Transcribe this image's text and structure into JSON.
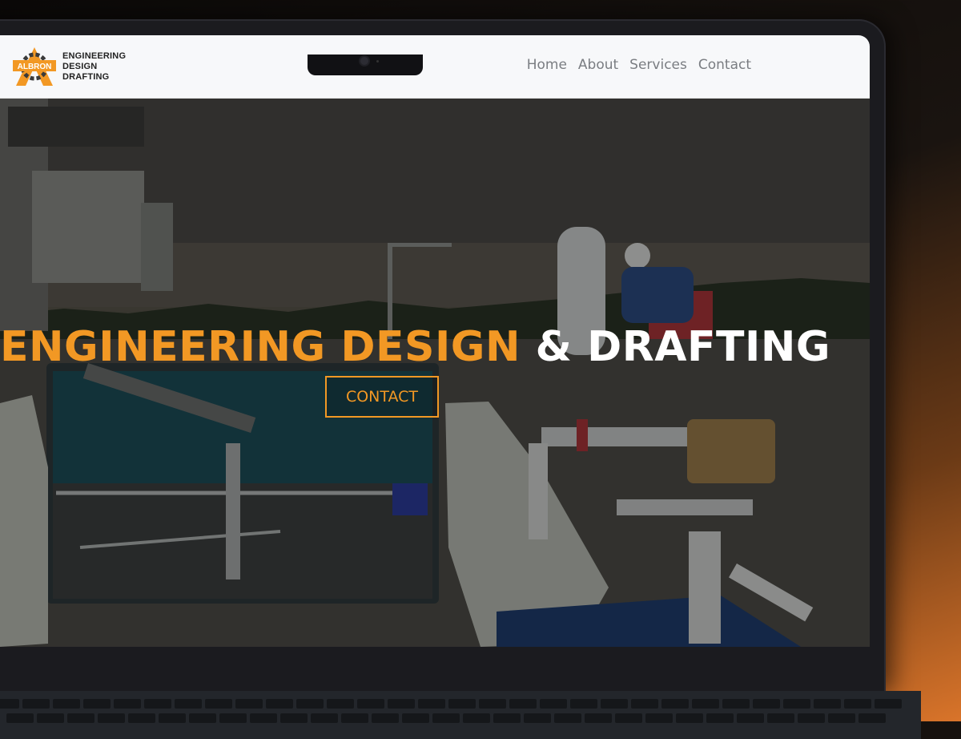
{
  "logo": {
    "mark_text": "ALBRON",
    "lines": [
      "ENGINEERING",
      "DESIGN",
      "DRAFTING"
    ]
  },
  "nav": {
    "items": [
      "Home",
      "About",
      "Services",
      "Contact"
    ]
  },
  "hero": {
    "title_accent": "ENGINEERING DESIGN",
    "title_rest": "& DRAFTING",
    "cta_label": "CONTACT"
  },
  "colors": {
    "accent": "#f29824",
    "nav_bg": "#f7f8fa",
    "nav_text": "#7a7d82"
  }
}
